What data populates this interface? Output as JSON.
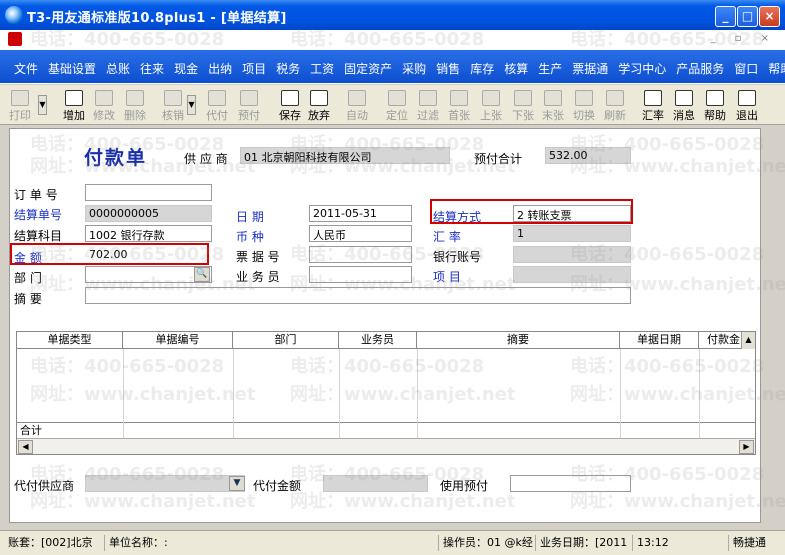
{
  "window": {
    "title": "T3-用友通标准版10.8plus1 - [单据结算]",
    "minimize_symbol": "_",
    "maximize_symbol": "□",
    "close_symbol": "×"
  },
  "menu": {
    "items": [
      "文件",
      "基础设置",
      "总账",
      "往来",
      "现金",
      "出纳",
      "项目",
      "税务",
      "工资",
      "固定资产",
      "采购",
      "销售",
      "库存",
      "核算",
      "生产",
      "票据通",
      "学习中心",
      "产品服务",
      "窗口",
      "帮助"
    ]
  },
  "toolbar": {
    "items": [
      {
        "label": "打印",
        "icon": "printer-icon",
        "enabled": false
      },
      {
        "label": "增加",
        "icon": "add-icon",
        "enabled": true
      },
      {
        "label": "修改",
        "icon": "edit-icon",
        "enabled": false
      },
      {
        "label": "删除",
        "icon": "delete-icon",
        "enabled": false
      },
      {
        "label": "核销",
        "icon": "writeoff-icon",
        "enabled": false
      },
      {
        "label": "代付",
        "icon": "proxy-pay-icon",
        "enabled": false
      },
      {
        "label": "预付",
        "icon": "prepay-icon",
        "enabled": false
      },
      {
        "label": "保存",
        "icon": "save-icon",
        "enabled": true
      },
      {
        "label": "放弃",
        "icon": "discard-icon",
        "enabled": true
      },
      {
        "label": "自动",
        "icon": "auto-icon",
        "enabled": false
      },
      {
        "label": "定位",
        "icon": "locate-icon",
        "enabled": false
      },
      {
        "label": "过滤",
        "icon": "filter-icon",
        "enabled": false
      },
      {
        "label": "首张",
        "icon": "first-icon",
        "enabled": false
      },
      {
        "label": "上张",
        "icon": "prev-icon",
        "enabled": false
      },
      {
        "label": "下张",
        "icon": "next-icon",
        "enabled": false
      },
      {
        "label": "末张",
        "icon": "last-icon",
        "enabled": false
      },
      {
        "label": "切换",
        "icon": "switch-icon",
        "enabled": false
      },
      {
        "label": "刷新",
        "icon": "refresh-icon",
        "enabled": false
      },
      {
        "label": "汇率",
        "icon": "exchange-rate-icon",
        "enabled": true
      },
      {
        "label": "消息",
        "icon": "message-icon",
        "enabled": true
      },
      {
        "label": "帮助",
        "icon": "help-icon",
        "enabled": true
      },
      {
        "label": "退出",
        "icon": "exit-icon",
        "enabled": true
      }
    ]
  },
  "form": {
    "title": "付款单",
    "supplier_label": "供 应 商",
    "supplier_value": "01  北京朝阳科技有限公司",
    "prepaid_total_label": "预付合计",
    "prepaid_total_value": "532.00",
    "order_no_label": "订 单 号",
    "order_no_value": "",
    "settle_no_label": "结算单号",
    "settle_no_value": "0000000005",
    "date_label": "日  期",
    "date_value": "2011-05-31",
    "settle_method_label": "结算方式",
    "settle_method_value": "2  转账支票",
    "settle_subject_label": "结算科目",
    "settle_subject_value": "1002  银行存款",
    "currency_label": "币  种",
    "currency_value": "人民币",
    "exchange_rate_label": "汇  率",
    "exchange_rate_value": "1",
    "amount_label": "金  额",
    "amount_value": "702.00",
    "bill_no_label": "票 据 号",
    "bill_no_value": "",
    "bank_account_label": "银行账号",
    "bank_account_value": "",
    "dept_label": "部  门",
    "dept_value": "",
    "staff_label": "业 务 员",
    "staff_value": "",
    "project_label": "项  目",
    "project_value": "",
    "summary_label": "摘  要",
    "summary_value": ""
  },
  "grid": {
    "columns": [
      "单据类型",
      "单据编号",
      "部门",
      "业务员",
      "摘要",
      "单据日期",
      "付款金"
    ],
    "total_label": "合计"
  },
  "bottom": {
    "proxy_supplier_label": "代付供应商",
    "proxy_amount_label": "代付金额",
    "use_prepaid_label": "使用预付"
  },
  "statusbar": {
    "account": "账套：[002]北京",
    "unit": "单位名称：:",
    "operator": "操作员：01 @k经",
    "business_date": "业务日期：[2011",
    "time": "13:12",
    "brand": "畅捷通"
  },
  "watermark": {
    "phone": "电话：400-665-0028",
    "site": "网址：www.chanjet.net"
  },
  "colors": {
    "titlebar": "#0053e0",
    "menubar": "#0d4fd0",
    "label_blue": "#1a30c0",
    "highlight_red": "#d40000",
    "form_title": "#1a2fa8"
  }
}
